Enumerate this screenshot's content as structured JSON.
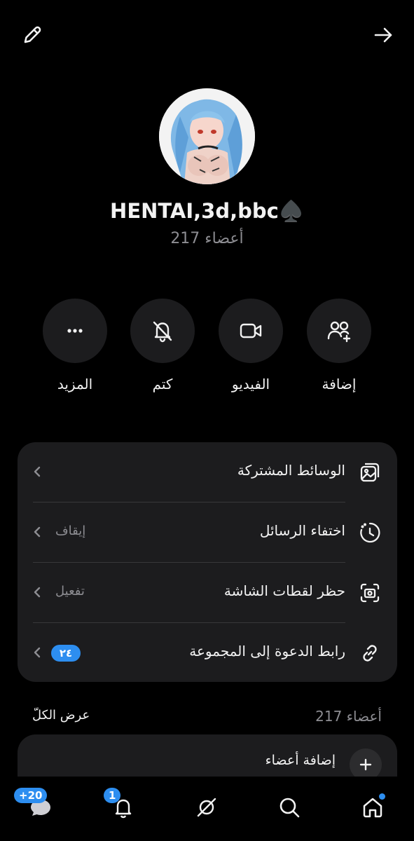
{
  "group": {
    "name": "HENTAI,3d,bbc♠️",
    "member_count": "217 أعضاء"
  },
  "actions": [
    {
      "label": "إضافة",
      "icon": "add-people-icon"
    },
    {
      "label": "الفيديو",
      "icon": "video-icon"
    },
    {
      "label": "كتم",
      "icon": "mute-bell-icon"
    },
    {
      "label": "المزيد",
      "icon": "more-icon"
    }
  ],
  "settings": [
    {
      "title": "الوسائط المشتركة",
      "value": "",
      "icon": "media-gallery-icon"
    },
    {
      "title": "اختفاء الرسائل",
      "value": "إيقاف",
      "icon": "timer-icon"
    },
    {
      "title": "حظر لقطات الشاشة",
      "value": "تفعيل",
      "icon": "screenshot-icon"
    },
    {
      "title": "رابط الدعوة إلى المجموعة",
      "badge": "٢٤",
      "icon": "link-icon"
    }
  ],
  "members": {
    "count": "217 أعضاء",
    "view_all": "عرض الكلّ",
    "add_label": "إضافة أعضاء"
  },
  "tabbar": {
    "chats_badge": "+20",
    "notifications_badge": "1"
  },
  "colors": {
    "accent": "#2d8ef0",
    "card": "#1c1c1e",
    "muted": "#8d8d92"
  }
}
